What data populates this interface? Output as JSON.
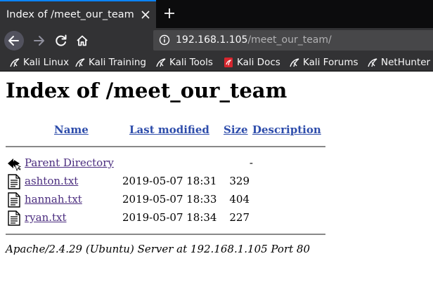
{
  "browser": {
    "tab_title": "Index of /meet_our_team",
    "url_host": "192.168.1.105",
    "url_path": "/meet_our_team/",
    "accent_color": "#0a84ff",
    "bookmarks": [
      {
        "label": "Kali Linux",
        "icon": "kali-dragon-icon"
      },
      {
        "label": "Kali Training",
        "icon": "kali-dragon-icon"
      },
      {
        "label": "Kali Tools",
        "icon": "kali-dragon-icon"
      },
      {
        "label": "Kali Docs",
        "icon": "kali-docs-icon"
      },
      {
        "label": "Kali Forums",
        "icon": "kali-dragon-icon"
      },
      {
        "label": "NetHunter",
        "icon": "kali-dragon-icon"
      }
    ]
  },
  "page": {
    "heading": "Index of /meet_our_team",
    "columns": {
      "name": "Name",
      "last_modified": "Last modified",
      "size": "Size",
      "description": "Description"
    },
    "parent": {
      "name": "Parent Directory",
      "size": "-",
      "icon": "back-arrow-icon"
    },
    "files": [
      {
        "name": "ashton.txt",
        "modified": "2019-05-07 18:31",
        "size": "329",
        "icon": "text-file-icon"
      },
      {
        "name": "hannah.txt",
        "modified": "2019-05-07 18:33",
        "size": "404",
        "icon": "text-file-icon"
      },
      {
        "name": "ryan.txt",
        "modified": "2019-05-07 18:34",
        "size": "227",
        "icon": "text-file-icon"
      }
    ],
    "footer": "Apache/2.4.29 (Ubuntu) Server at 192.168.1.105 Port 80",
    "link_color": "#2e4dab",
    "visited_link_color": "#4b2d7f"
  }
}
